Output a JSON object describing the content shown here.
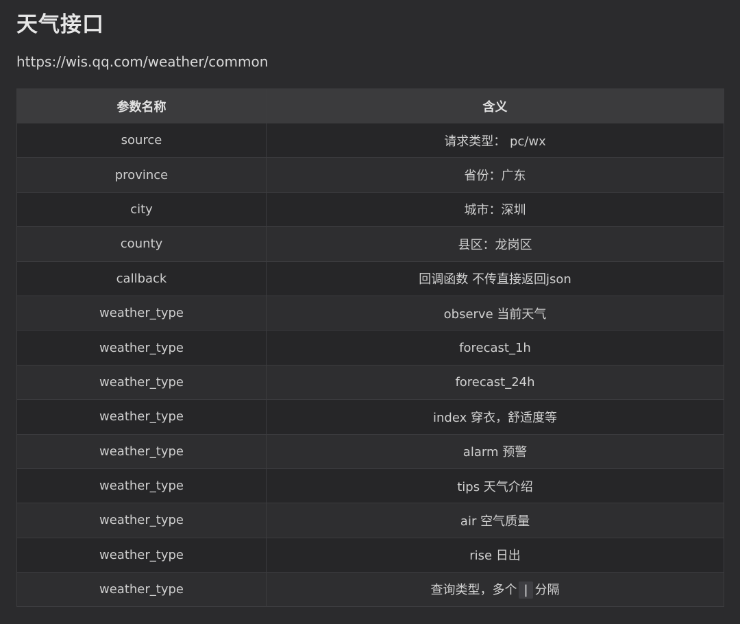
{
  "doc": {
    "title": "天气接口",
    "url": "https://wis.qq.com/weather/common"
  },
  "table": {
    "headers": [
      "参数名称",
      "含义"
    ],
    "rows": [
      {
        "param": "source",
        "desc": "请求类型： pc/wx"
      },
      {
        "param": "province",
        "desc": "省份：广东"
      },
      {
        "param": "city",
        "desc": "城市：深圳"
      },
      {
        "param": "county",
        "desc": "县区：龙岗区"
      },
      {
        "param": "callback",
        "desc": "回调函数 不传直接返回json"
      },
      {
        "param": "weather_type",
        "desc": "observe 当前天气"
      },
      {
        "param": "weather_type",
        "desc": "forecast_1h"
      },
      {
        "param": "weather_type",
        "desc": "forecast_24h"
      },
      {
        "param": "weather_type",
        "desc": "index 穿衣，舒适度等"
      },
      {
        "param": "weather_type",
        "desc": "alarm 预警"
      },
      {
        "param": "weather_type",
        "desc": "tips 天气介绍"
      },
      {
        "param": "weather_type",
        "desc": "air 空气质量"
      },
      {
        "param": "weather_type",
        "desc": "rise 日出"
      },
      {
        "param": "weather_type",
        "desc_before": "查询类型，多个",
        "desc_code": "|",
        "desc_after": "分隔"
      }
    ]
  }
}
